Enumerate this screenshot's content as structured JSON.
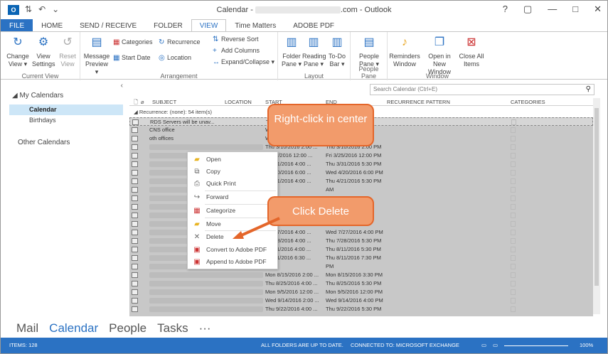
{
  "window": {
    "app_icon": "O",
    "title_prefix": "Calendar - ",
    "title_suffix": ".com - Outlook",
    "help": "?",
    "restore": "▢",
    "minimize": "—",
    "maximize": "□",
    "close": "✕"
  },
  "tabs": [
    "FILE",
    "HOME",
    "SEND / RECEIVE",
    "FOLDER",
    "VIEW",
    "Time Matters",
    "ADOBE PDF"
  ],
  "ribbon": {
    "current_view": {
      "change_view": "Change View ▾",
      "view_settings": "View Settings",
      "reset_view": "Reset View",
      "label": "Current View"
    },
    "arrangement": {
      "message_preview": "Message Preview ▾",
      "categories": "Categories",
      "start_date": "Start Date",
      "recurrence": "Recurrence",
      "location": "Location",
      "reverse_sort": "Reverse Sort",
      "add_columns": "Add Columns",
      "expand_collapse": "Expand/Collapse ▾",
      "label": "Arrangement"
    },
    "layout": {
      "folder_pane": "Folder Pane ▾",
      "reading_pane": "Reading Pane ▾",
      "todo_bar": "To-Do Bar ▾",
      "label": "Layout"
    },
    "people_pane": {
      "people_pane": "People Pane ▾",
      "label": "People Pane"
    },
    "window": {
      "reminders": "Reminders Window",
      "open_new": "Open in New Window",
      "close_all": "Close All Items",
      "label": "Window"
    }
  },
  "nav": {
    "collapse": "‹",
    "group": "◢ My Calendars",
    "items": [
      "Calendar",
      "Birthdays"
    ],
    "other": "Other Calendars"
  },
  "list": {
    "search_placeholder": "Search Calendar (Ctrl+E)",
    "headers": {
      "subject": "SUBJECT",
      "location": "LOCATION",
      "start": "START",
      "end": "END",
      "recurrence": "RECURRENCE PATTERN",
      "categories": "CATEGORIES"
    },
    "group_row": "◢  Recurrence: (none): 54 item(s)",
    "rows": [
      {
        "subject": "RDS Servers will be unav...",
        "start": "T",
        "end": "M"
      },
      {
        "subject": "CNS office",
        "start": "W",
        "end": "M"
      },
      {
        "subject": "oth offices",
        "start": "W",
        "end": "M"
      },
      {
        "subject": "",
        "start": "Thu 3/10/2016 2:00 ...",
        "end": "Thu 3/10/2016 2:00 PM"
      },
      {
        "subject": "",
        "start": "i 3/25/2016 12:00 ...",
        "end": "Fri 3/25/2016 12:00 PM"
      },
      {
        "subject": "",
        "start": "u 3/31/2016 4:00 ...",
        "end": "Thu 3/31/2016 5:30 PM"
      },
      {
        "subject": "",
        "start": "d 4/20/2016 6:00 ...",
        "end": "Wed 4/20/2016 6:00 PM"
      },
      {
        "subject": "",
        "start": "u 4/21/2016 4:00 ...",
        "end": "Thu 4/21/2016 5:30 PM"
      },
      {
        "subject": "",
        "start": "",
        "end": "AM"
      },
      {
        "subject": "",
        "start": "",
        "end": "PM"
      },
      {
        "subject": "",
        "start": "",
        "end": "PM"
      },
      {
        "subject": "",
        "start": "",
        "end": "PM"
      },
      {
        "subject": "",
        "start": "",
        "end": "PM"
      },
      {
        "subject": "",
        "start": "d 7/27/2016 4:00 ...",
        "end": "Wed 7/27/2016 4:00 PM"
      },
      {
        "subject": "",
        "start": "u 7/28/2016 4:00 ...",
        "end": "Thu 7/28/2016 5:30 PM"
      },
      {
        "subject": "",
        "start": "u 8/11/2016 4:00 ...",
        "end": "Thu 8/11/2016 5:30 PM"
      },
      {
        "subject": "",
        "start": "u 8/11/2016 6:30 ...",
        "end": "Thu 8/11/2016 7:30 PM"
      },
      {
        "subject": "",
        "start": "",
        "end": "PM"
      },
      {
        "subject": "",
        "start": "Mon 8/15/2016 2:00 ...",
        "end": "Mon 8/15/2016 3:30 PM"
      },
      {
        "subject": "",
        "start": "Thu 8/25/2016 4:00 ...",
        "end": "Thu 8/25/2016 5:30 PM"
      },
      {
        "subject": "",
        "start": "Mon 9/5/2016 12:00 ...",
        "end": "Mon 9/5/2016 12:00 PM"
      },
      {
        "subject": "",
        "start": "Wed 9/14/2016 2:00 ...",
        "end": "Wed 9/14/2016 4:00 PM"
      },
      {
        "subject": "",
        "start": "Thu 9/22/2016 4:00 ...",
        "end": "Thu 9/22/2016 5:30 PM"
      }
    ]
  },
  "context_menu": [
    "Open",
    "Copy",
    "Quick Print",
    "Forward",
    "Categorize",
    "Move",
    "Delete",
    "Convert to Adobe PDF",
    "Append to Adobe PDF"
  ],
  "callouts": {
    "right_click": "Right-click in center",
    "click_delete": "Click Delete"
  },
  "bottom_nav": [
    "Mail",
    "Calendar",
    "People",
    "Tasks",
    "···"
  ],
  "status": {
    "items": "ITEMS: 128",
    "folders": "ALL FOLDERS ARE UP TO DATE.",
    "connected": "CONNECTED TO: MICROSOFT EXCHANGE",
    "zoom": "100%"
  },
  "colors": {
    "accent": "#2b72c3",
    "callout_fill": "#f29b6b",
    "callout_border": "#e4662a"
  }
}
